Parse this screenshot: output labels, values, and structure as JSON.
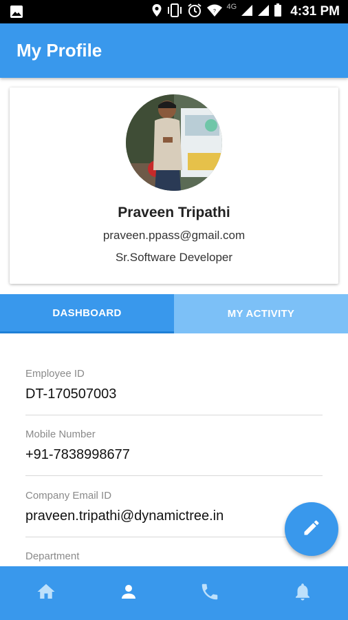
{
  "status_bar": {
    "network": "4G",
    "time": "4:31 PM",
    "icons": [
      "image-icon",
      "location-icon",
      "vibrate-icon",
      "alarm-icon",
      "wifi-icon",
      "signal-icon",
      "signal-icon",
      "battery-icon"
    ]
  },
  "app_bar": {
    "title": "My Profile"
  },
  "profile": {
    "name": "Praveen Tripathi",
    "email": "praveen.ppass@gmail.com",
    "designation": "Sr.Software Developer"
  },
  "tabs": [
    {
      "label": "DASHBOARD",
      "active": true
    },
    {
      "label": "MY ACTIVITY",
      "active": false
    }
  ],
  "fields": [
    {
      "label": "Employee ID",
      "value": "DT-170507003"
    },
    {
      "label": "Mobile Number",
      "value": "+91-7838998677"
    },
    {
      "label": "Company Email ID",
      "value": "praveen.tripathi@dynamictree.in"
    },
    {
      "label": "Department",
      "value": ""
    }
  ],
  "fab": {
    "icon": "edit-icon"
  },
  "bottom_nav": {
    "items": [
      {
        "icon": "home-icon",
        "active": false
      },
      {
        "icon": "person-icon",
        "active": true
      },
      {
        "icon": "phone-icon",
        "active": false
      },
      {
        "icon": "bell-icon",
        "active": false
      }
    ]
  },
  "colors": {
    "primary": "#3998ec",
    "tab_inactive": "#7cc0f7",
    "status_bar": "#000000",
    "icon_inactive": "#bde0fb"
  }
}
